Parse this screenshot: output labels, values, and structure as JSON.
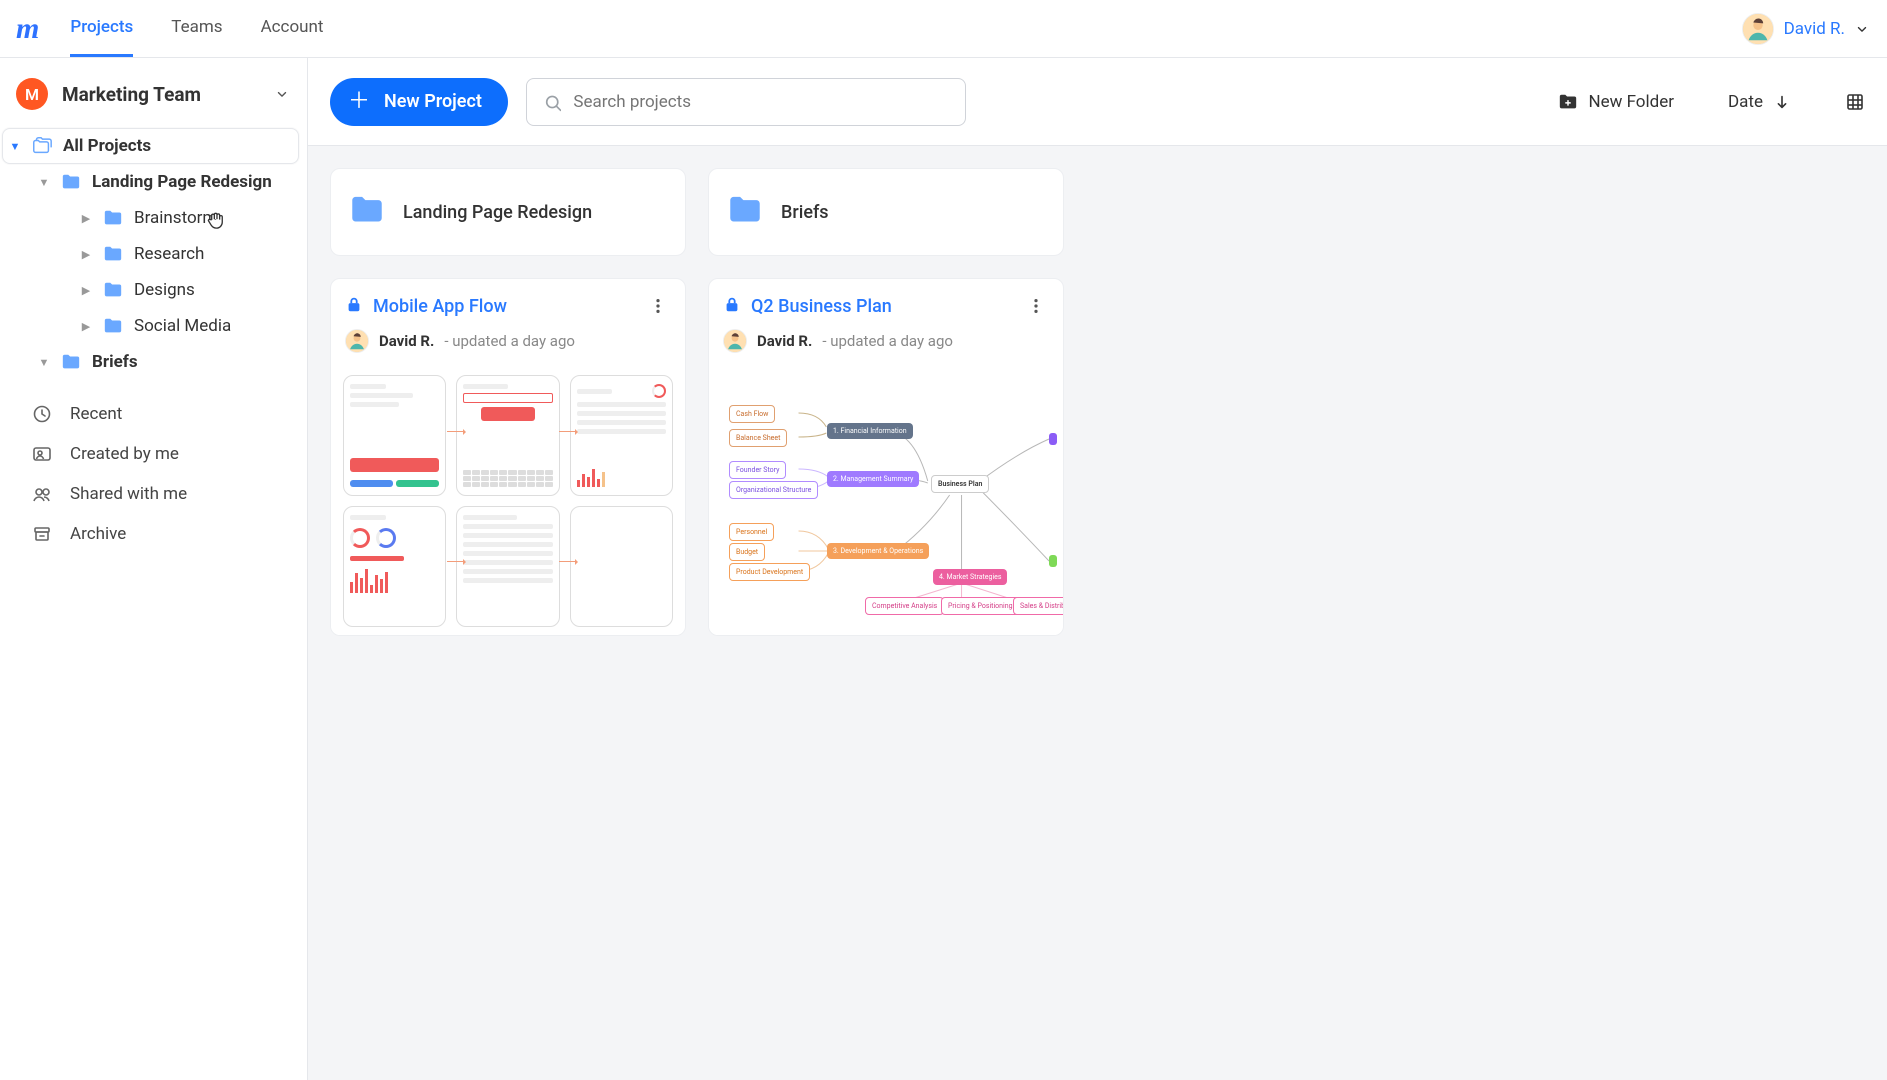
{
  "nav": {
    "tabs": [
      "Projects",
      "Teams",
      "Account"
    ],
    "active": 0,
    "user": "David R."
  },
  "team": {
    "initial": "M",
    "name": "Marketing Team"
  },
  "tree": {
    "root": "All Projects",
    "lpr": "Landing Page Redesign",
    "children": [
      "Brainstorm",
      "Research",
      "Designs",
      "Social Media"
    ],
    "briefs": "Briefs"
  },
  "filters": [
    "Recent",
    "Created by me",
    "Shared with me",
    "Archive"
  ],
  "toolbar": {
    "new_project": "New Project",
    "search_placeholder": "Search projects",
    "new_folder": "New Folder",
    "sort_label": "Date"
  },
  "folders": [
    {
      "title": "Landing Page Redesign"
    },
    {
      "title": "Briefs"
    }
  ],
  "projects": [
    {
      "title": "Mobile App Flow",
      "owner": "David R.",
      "updated": "- updated a day ago"
    },
    {
      "title": "Q2 Business Plan",
      "owner": "David R.",
      "updated": "- updated a day ago"
    }
  ],
  "mindmap": {
    "center": "Business Plan",
    "l1a": "Cash Flow",
    "l1b": "Balance Sheet",
    "l2a": "Founder Story",
    "l2b": "Organizational Structure",
    "l3a": "Personnel",
    "l3b": "Budget",
    "l3c": "Product Development",
    "c1": "1. Financial Information",
    "c2": "2. Management Summary",
    "c3": "3. Development & Operations",
    "c4": "4. Market Strategies",
    "b1": "Competitive Analysis",
    "b2": "Pricing & Positioning",
    "b3": "Sales & Distribution"
  }
}
